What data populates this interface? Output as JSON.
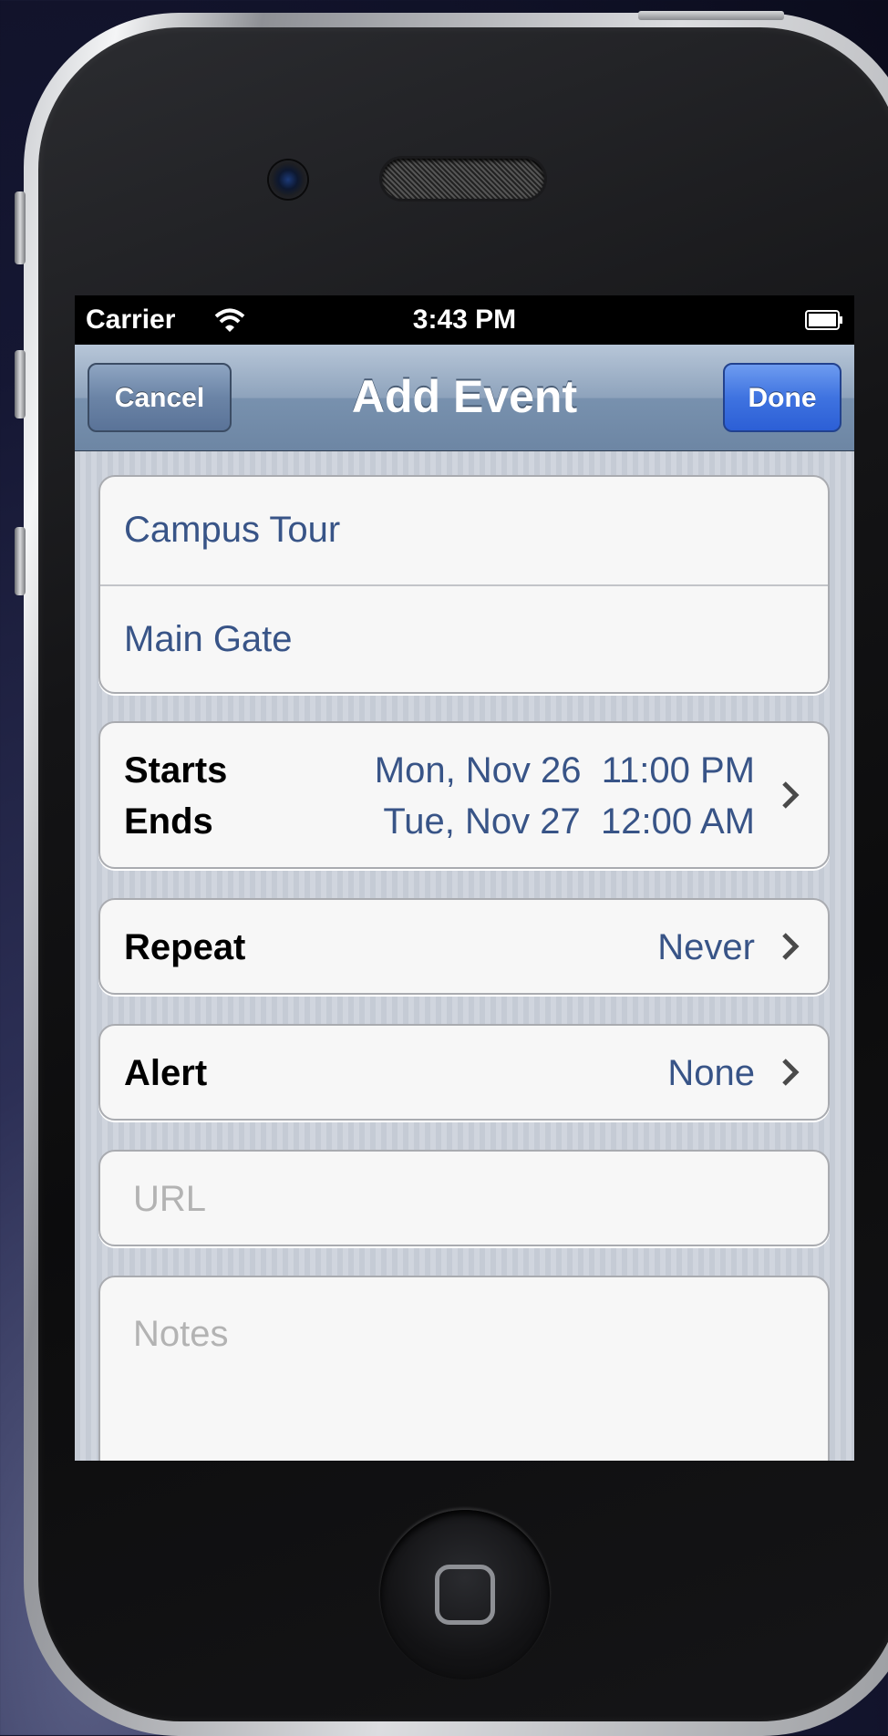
{
  "status_bar": {
    "carrier": "Carrier",
    "time": "3:43 PM"
  },
  "nav": {
    "title": "Add Event",
    "cancel_label": "Cancel",
    "done_label": "Done"
  },
  "event": {
    "title": "Campus Tour",
    "location": "Main Gate",
    "starts_label": "Starts",
    "starts_value": "Mon, Nov 26  11:00 PM",
    "ends_label": "Ends",
    "ends_value": "Tue, Nov 27  12:00 AM",
    "repeat_label": "Repeat",
    "repeat_value": "Never",
    "alert_label": "Alert",
    "alert_value": "None",
    "url_placeholder": "URL",
    "notes_placeholder": "Notes"
  },
  "icons": {
    "wifi": "wifi-icon",
    "battery": "battery-icon",
    "disclosure": "chevron-right-icon",
    "camera": "front-camera-icon",
    "home": "home-button-icon"
  },
  "colors": {
    "value_blue": "#385487",
    "done_blue": "#3f73e0",
    "navbar": "#8ea3bc"
  }
}
